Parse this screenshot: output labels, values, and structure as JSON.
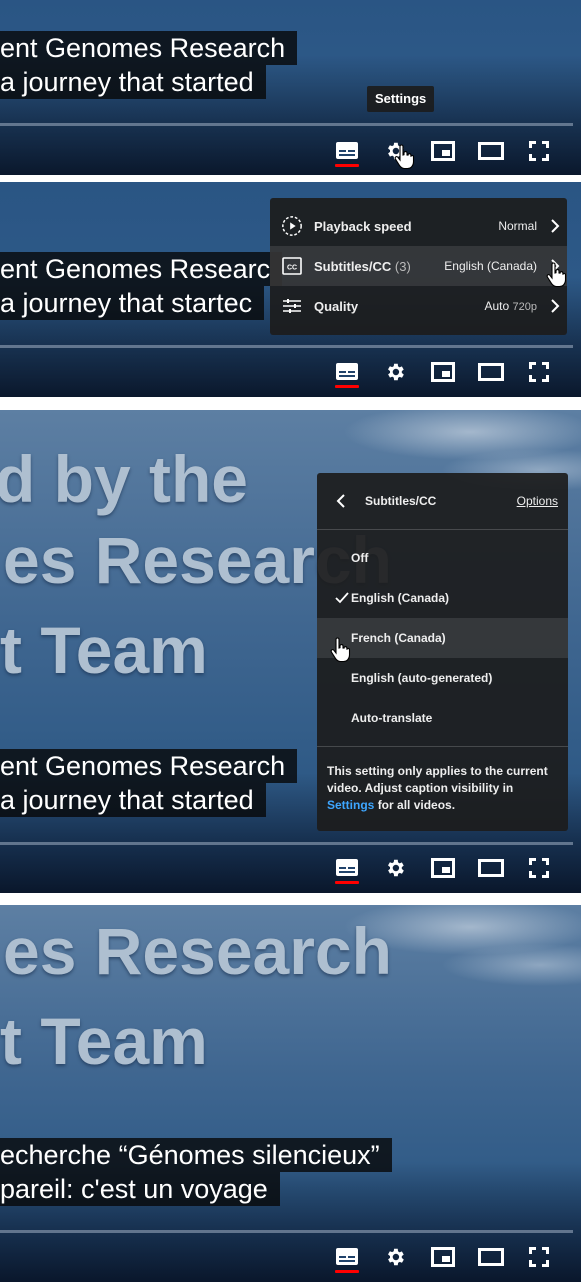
{
  "video": {
    "title_lines": [
      "d by the",
      "es Research",
      "t Team"
    ]
  },
  "captions": {
    "english": [
      "ent Genomes Research",
      "a journey that started"
    ],
    "english_cut": [
      "ent Genomes Researc",
      "a journey that startec"
    ],
    "french": [
      "echerche “Génomes silencieux”",
      "pareil: c'est un voyage"
    ]
  },
  "controls": {
    "subtitles_icon": "subtitles-icon",
    "settings_icon": "gear-icon",
    "miniplayer_icon": "miniplayer-icon",
    "theater_icon": "theater-mode-icon",
    "fullscreen_icon": "fullscreen-icon",
    "active_color": "#ff0000"
  },
  "tooltip": {
    "settings": "Settings"
  },
  "settings_menu": {
    "items": [
      {
        "icon": "playback-speed-icon",
        "label": "Playback speed",
        "count": "",
        "value": "Normal",
        "value_sub": ""
      },
      {
        "icon": "cc-icon",
        "label": "Subtitles/CC",
        "count": "(3)",
        "value": "English (Canada)",
        "value_sub": ""
      },
      {
        "icon": "sliders-icon",
        "label": "Quality",
        "count": "",
        "value": "Auto",
        "value_sub": "720p"
      }
    ]
  },
  "subtitles_menu": {
    "title": "Subtitles/CC",
    "options_label": "Options",
    "tracks": [
      {
        "label": "Off",
        "selected": false
      },
      {
        "label": "English (Canada)",
        "selected": true
      },
      {
        "label": "French (Canada)",
        "selected": false
      },
      {
        "label": "English (auto-generated)",
        "selected": false
      },
      {
        "label": "Auto-translate",
        "selected": false
      }
    ],
    "note_before": "This setting only applies to the current video. Adjust caption visibility in",
    "note_link": "Settings",
    "note_after": "for all videos."
  }
}
